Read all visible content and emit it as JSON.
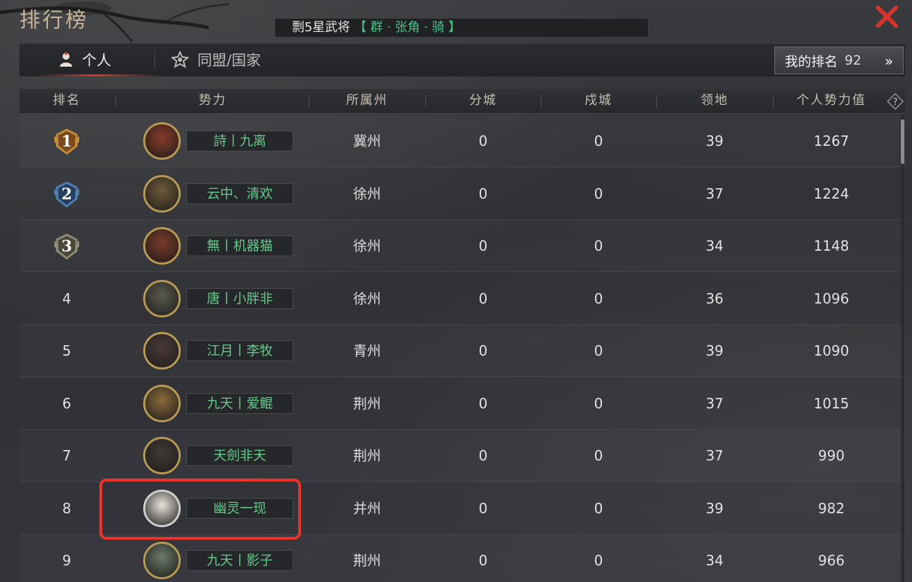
{
  "window": {
    "title": "排行榜",
    "close_icon": "close-x-icon",
    "accent": "#d23a2a",
    "name_color": "#66c98a"
  },
  "notice": {
    "prefix": "剽5星武将",
    "highlight": "【 群 · 张角 · 骑 】"
  },
  "tabs": [
    {
      "label": "个人",
      "icon": "person-icon",
      "active": true
    },
    {
      "label": "同盟/国家",
      "icon": "alliance-icon",
      "active": false
    }
  ],
  "my_rank": {
    "label": "我的排名",
    "value": "92",
    "chevron": "»"
  },
  "columns": [
    "排名",
    "势力",
    "所属州",
    "分城",
    "戍城",
    "领地",
    "个人势力值"
  ],
  "rows": [
    {
      "rank": "1",
      "name": "詩丨九离",
      "state": "冀州",
      "branch_city": "0",
      "fort": "0",
      "territory": "39",
      "power": "1267",
      "badge": "gold"
    },
    {
      "rank": "2",
      "name": "云中、清欢",
      "state": "徐州",
      "branch_city": "0",
      "fort": "0",
      "territory": "37",
      "power": "1224",
      "badge": "blue"
    },
    {
      "rank": "3",
      "name": "無丨机器猫",
      "state": "徐州",
      "branch_city": "0",
      "fort": "0",
      "territory": "34",
      "power": "1148",
      "badge": "gray"
    },
    {
      "rank": "4",
      "name": "唐丨小胖非",
      "state": "徐州",
      "branch_city": "0",
      "fort": "0",
      "territory": "36",
      "power": "1096",
      "badge": ""
    },
    {
      "rank": "5",
      "name": "江月丨李牧",
      "state": "青州",
      "branch_city": "0",
      "fort": "0",
      "territory": "39",
      "power": "1090",
      "badge": ""
    },
    {
      "rank": "6",
      "name": "九天丨爱鲲",
      "state": "荆州",
      "branch_city": "0",
      "fort": "0",
      "territory": "37",
      "power": "1015",
      "badge": ""
    },
    {
      "rank": "7",
      "name": "天劍非天",
      "state": "荆州",
      "branch_city": "0",
      "fort": "0",
      "territory": "37",
      "power": "990",
      "badge": ""
    },
    {
      "rank": "8",
      "name": "幽灵一现",
      "state": "并州",
      "branch_city": "0",
      "fort": "0",
      "territory": "39",
      "power": "982",
      "badge": ""
    },
    {
      "rank": "9",
      "name": "九天丨影子",
      "state": "荆州",
      "branch_city": "0",
      "fort": "0",
      "territory": "34",
      "power": "966",
      "badge": ""
    }
  ]
}
